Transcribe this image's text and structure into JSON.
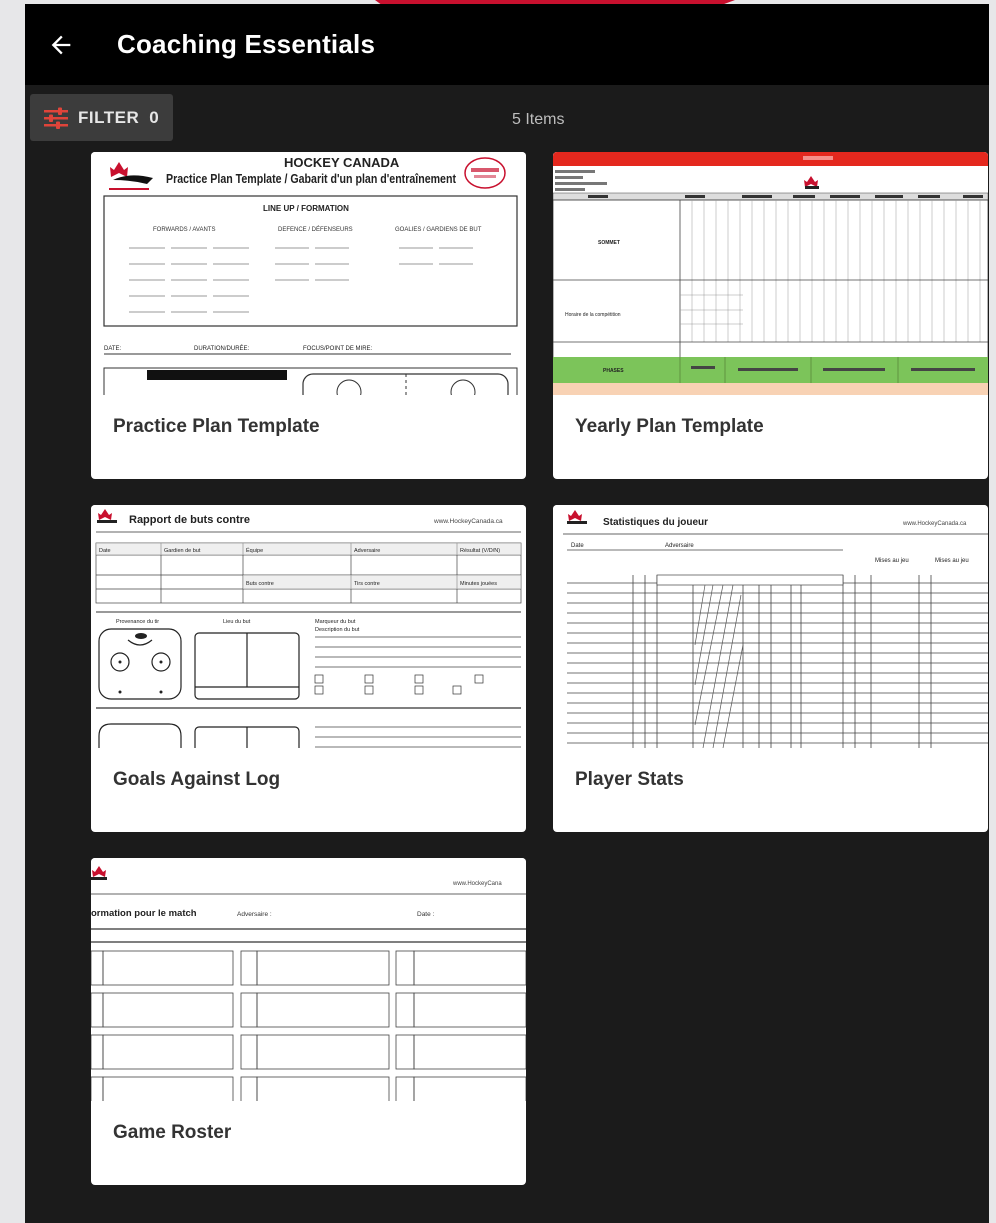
{
  "header": {
    "title": "Coaching Essentials"
  },
  "toolbar": {
    "filter_label": "FILTER",
    "filter_count": "0",
    "items_count": "5 Items"
  },
  "cards": [
    {
      "title": "Practice Plan Template",
      "preview": {
        "heading": "HOCKEY CANADA",
        "subheading": "Practice Plan Template / Gabarit d'un plan d'entraînement",
        "section": "LINE UP / FORMATION",
        "col1": "FORWARDS / AVANTS",
        "col2": "DEFENCE / DÉFENSEURS",
        "col3": "GOALIES / GARDIENS DE BUT",
        "row_label_1": "DATE:",
        "row_label_2": "DURATION/DURÉE:",
        "row_label_3": "FOCUS/POINT DE MIRE:"
      }
    },
    {
      "title": "Yearly Plan Template",
      "preview": {
        "row_a": "SOMMET",
        "row_b": "Horaire de la compétition",
        "row_c": "PHASES",
        "months": [
          "Août",
          "Septembre",
          "Octobre",
          "Novembre",
          "Décembre",
          "Janvier",
          "Février"
        ]
      }
    },
    {
      "title": "Goals Against Log",
      "preview": {
        "heading": "Rapport de buts contre",
        "site": "www.HockeyCanada.ca",
        "h1": "Date",
        "h2": "Gardien de but",
        "h3": "Équipe",
        "h4": "Adversaire",
        "h5": "Résultat (V/D/N)",
        "h6": "Buts contre",
        "h7": "Tirs contre",
        "h8": "Minutes jouées",
        "l1": "Provenance du tir",
        "l2": "Lieu du but",
        "l3": "Marqueur du but",
        "l4": "Description du but"
      }
    },
    {
      "title": "Player Stats",
      "preview": {
        "heading": "Statistiques du joueur",
        "site": "www.HockeyCanada.ca",
        "h1": "Date",
        "h2": "Adversaire",
        "h3": "Mises au jeu",
        "h4": "Mises au jeu"
      }
    },
    {
      "title": "Game Roster",
      "preview": {
        "site": "www.HockeyCana",
        "heading": "ormation pour le match",
        "opp": "Adversaire :",
        "date": "Date :"
      }
    }
  ],
  "colors": {
    "app_bar": "#000000",
    "background": "#1b1b1b",
    "card": "#ffffff",
    "accent_red": "#c8102e",
    "yearly_green": "#7cc45a",
    "yearly_peach": "#f8d2b4"
  }
}
